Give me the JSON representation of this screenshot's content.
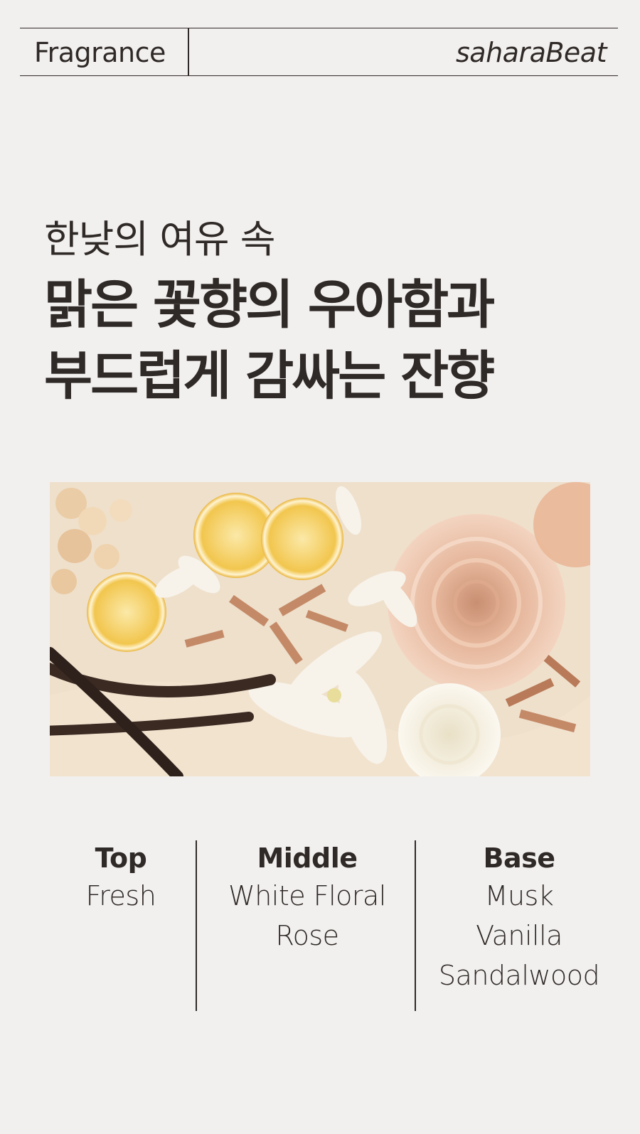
{
  "header": {
    "left_label": "Fragrance",
    "right_label": "saharaBeat"
  },
  "headline": {
    "subtitle": "한낮의 여유 속",
    "line1": "맑은 꽃향의 우아함과",
    "line2": "부드럽게 감싸는 잔향"
  },
  "photo": {
    "subjects": [
      "sugar-crystals",
      "lemon-slice",
      "lemon-slice",
      "lemon-slice",
      "white-flower",
      "white-flower",
      "white-flower",
      "rose",
      "white-rose",
      "sandalwood-chips",
      "vanilla-pod"
    ],
    "colors": {
      "background": "#efe0cc",
      "lemon": "#f2c64e",
      "rose": "#eec6ad",
      "vanilla": "#3a2a22",
      "sandalwood": "#c48a68",
      "white_flower": "#f7f3ea"
    }
  },
  "notes": {
    "top": {
      "title": "Top",
      "items": [
        "Fresh"
      ]
    },
    "middle": {
      "title": "Middle",
      "items": [
        "White Floral",
        "Rose"
      ]
    },
    "base": {
      "title": "Base",
      "items": [
        "Musk",
        "Vanilla",
        "Sandalwood"
      ]
    }
  },
  "colors": {
    "background": "#f2f0ef",
    "text": "#2f2a27"
  }
}
